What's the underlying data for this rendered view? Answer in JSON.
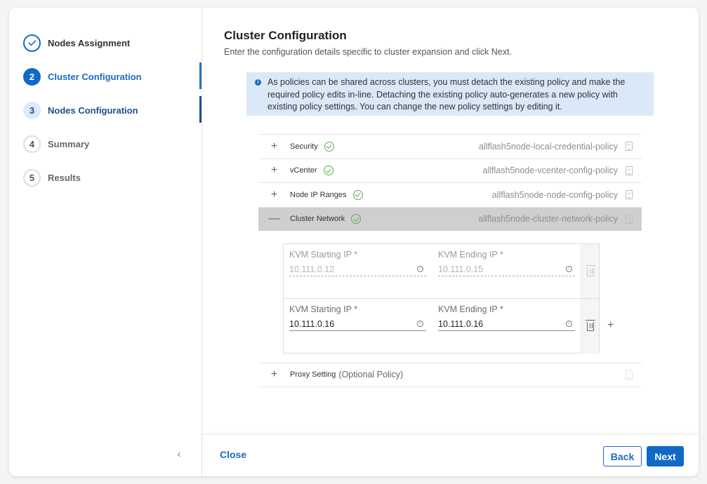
{
  "wizard": {
    "steps": [
      {
        "number": "✓",
        "label": "Nodes Assignment",
        "state": "done"
      },
      {
        "number": "2",
        "label": "Cluster Configuration",
        "state": "active"
      },
      {
        "number": "3",
        "label": "Nodes Configuration",
        "state": "next"
      },
      {
        "number": "4",
        "label": "Summary",
        "state": "future"
      },
      {
        "number": "5",
        "label": "Results",
        "state": "future"
      }
    ],
    "collapse_icon": "‹"
  },
  "header": {
    "title": "Cluster Configuration",
    "subtitle": "Enter the configuration details specific to cluster expansion and click Next."
  },
  "alert": {
    "icon": "info-icon",
    "text": "As policies can be shared across clusters, you must detach the existing policy and make the required policy edits in-line. Detaching the existing policy auto-generates a new policy with existing policy settings. You can change the new policy settings by editing it."
  },
  "policies": [
    {
      "toggle": "+",
      "name": "Security",
      "status": "valid",
      "policy": "allflash5node-local-credential-policy"
    },
    {
      "toggle": "+",
      "name": "vCenter",
      "status": "valid",
      "policy": "allflash5node-vcenter-config-policy"
    },
    {
      "toggle": "+",
      "name": "Node IP Ranges",
      "status": "valid",
      "policy": "allflash5node-node-config-policy"
    },
    {
      "toggle": "—",
      "name": "Cluster Network",
      "status": "valid",
      "policy": "allflash5node-cluster-network-policy",
      "expanded": true
    },
    {
      "toggle": "+",
      "name": "Proxy Setting",
      "optional_note": "(Optional Policy)",
      "policy": ""
    }
  ],
  "cluster_network": {
    "ranges": [
      {
        "start_label": "KVM Starting IP *",
        "start_value": "10.111.0.12",
        "end_label": "KVM Ending IP *",
        "end_value": "10.111.0.15",
        "disabled": true
      },
      {
        "start_label": "KVM Starting IP *",
        "start_value": "10.111.0.16",
        "end_label": "KVM Ending IP *",
        "end_value": "10.111.0.16",
        "disabled": false
      }
    ],
    "add_label": "+"
  },
  "footer": {
    "close_label": "Close",
    "back_label": "Back",
    "next_label": "Next"
  },
  "colors": {
    "accent": "#1069c6",
    "success": "#5aac4e",
    "alert_bg": "#dae8f7",
    "expanded_row_bg": "#cfcfcf"
  }
}
